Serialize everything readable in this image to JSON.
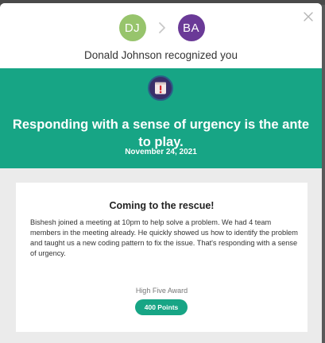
{
  "header": {
    "giver_initials": "DJ",
    "receiver_initials": "BA",
    "giver_name": "Donald Johnson",
    "recognized_text": "recognized you"
  },
  "value": {
    "icon": "exclamation-badge-icon",
    "title": "Responding with a sense of urgency is the ante to play.",
    "date": "November 24, 2021"
  },
  "card": {
    "title": "Coming to the rescue!",
    "message": "Bishesh joined a meeting at 10pm to help solve a problem. We had 4 team members in the meeting already. He quickly showed us how to identify the problem and taught us a new coding pattern to fix the issue. That's responding with a sense of urgency.",
    "award_label": "High Five Award",
    "points_label": "400 Points"
  },
  "colors": {
    "accent": "#17a585",
    "giver_avatar": "#97c46c",
    "receiver_avatar": "#6a3a97"
  }
}
